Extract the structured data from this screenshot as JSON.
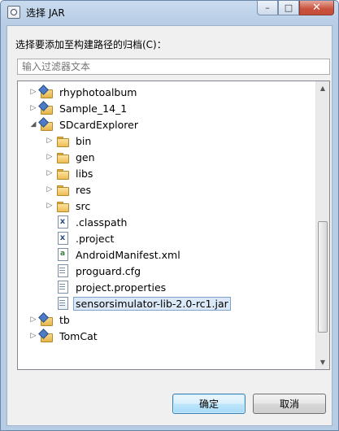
{
  "window": {
    "title": "选择 JAR",
    "controls": {
      "minimize": "–",
      "maximize": "□",
      "close": "✕"
    }
  },
  "prompt": "选择要添加至构建路径的归档(C)：",
  "filter": {
    "value": "",
    "placeholder": "输入过滤器文本"
  },
  "tree": {
    "items": [
      {
        "label": "rhyphotoalbum",
        "icon": "project-icon",
        "twisty": "collapsed"
      },
      {
        "label": "Sample_14_1",
        "icon": "project-icon",
        "twisty": "collapsed"
      },
      {
        "label": "SDcardExplorer",
        "icon": "project-icon",
        "twisty": "expanded"
      },
      {
        "label": "bin",
        "icon": "folder-icon",
        "twisty": "collapsed"
      },
      {
        "label": "gen",
        "icon": "folder-icon",
        "twisty": "collapsed"
      },
      {
        "label": "libs",
        "icon": "folder-icon",
        "twisty": "collapsed"
      },
      {
        "label": "res",
        "icon": "folder-icon",
        "twisty": "collapsed"
      },
      {
        "label": "src",
        "icon": "folder-icon",
        "twisty": "collapsed"
      },
      {
        "label": ".classpath",
        "icon": "xml-file-icon",
        "twisty": "none"
      },
      {
        "label": ".project",
        "icon": "xml-file-icon",
        "twisty": "none"
      },
      {
        "label": "AndroidManifest.xml",
        "icon": "android-manifest-icon",
        "twisty": "none"
      },
      {
        "label": "proguard.cfg",
        "icon": "text-file-icon",
        "twisty": "none"
      },
      {
        "label": "project.properties",
        "icon": "properties-file-icon",
        "twisty": "none"
      },
      {
        "label": "sensorsimulator-lib-2.0-rc1.jar",
        "icon": "jar-file-icon",
        "twisty": "none",
        "selected": true
      },
      {
        "label": "tb",
        "icon": "project-icon",
        "twisty": "collapsed"
      },
      {
        "label": "TomCat",
        "icon": "project-icon",
        "twisty": "collapsed"
      }
    ]
  },
  "buttons": {
    "ok": "确定",
    "cancel": "取消"
  },
  "colors": {
    "selection": "#dbe8f7",
    "selection_border": "#7da2ce",
    "accent": "#3c7fb1"
  }
}
